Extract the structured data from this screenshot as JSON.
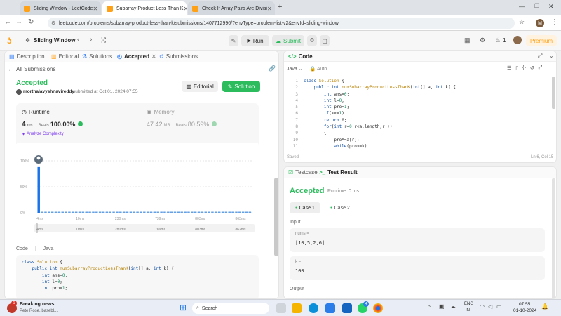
{
  "browser": {
    "tabs": [
      {
        "title": "Sliding Window - LeetCode"
      },
      {
        "title": "Subarray Product Less Than K"
      },
      {
        "title": "Check If Array Pairs Are Divisi"
      }
    ],
    "url": "leetcode.com/problems/subarray-product-less-than-k/submissions/1407712996/?envType=problem-list-v2&envId=sliding-window",
    "profile_initial": "M"
  },
  "lc_header": {
    "list_title": "Sliding Window",
    "run_label": "Run",
    "submit_label": "Submit",
    "streak": "1",
    "premium_label": "Premium"
  },
  "left_tabs": {
    "description": "Description",
    "editorial": "Editorial",
    "solutions": "Solutions",
    "accepted": "Accepted",
    "submissions": "Submissions"
  },
  "submission": {
    "back_label": "All Submissions",
    "status": "Accepted",
    "user": "morthalavyshnavireddy",
    "submitted_at": "submitted at Oct 01, 2024 07:55",
    "editorial_btn": "Editorial",
    "solution_btn": "Solution",
    "runtime_label": "Runtime",
    "runtime_value": "4",
    "runtime_unit": "ms",
    "runtime_beats_label": "Beats",
    "runtime_beats": "100.00%",
    "analyze_label": "Analyze Complexity",
    "memory_label": "Memory",
    "memory_value": "47.42",
    "memory_unit": "MB",
    "memory_beats_label": "Beats",
    "memory_beats": "80.59%"
  },
  "chart_data": {
    "type": "bar",
    "yticks": [
      "100%",
      "50%",
      "0%"
    ],
    "xticks": [
      "4ms",
      "10ms",
      "230ms",
      "739ms",
      "803ms",
      "863ms"
    ],
    "range_labels": [
      "4ms",
      "1mss",
      "280ms",
      "789ms",
      "803ms",
      "862ms"
    ],
    "values": [
      88,
      2,
      2,
      2,
      2,
      2,
      2,
      2,
      2,
      2,
      2,
      2,
      2,
      2,
      2,
      2,
      2,
      2,
      2,
      2,
      2,
      2,
      2,
      2,
      2,
      2,
      2,
      2,
      2,
      2,
      2,
      2,
      2,
      2,
      2,
      2,
      2,
      2,
      2,
      2,
      2,
      2,
      2,
      2,
      2,
      2,
      2,
      2,
      2,
      2,
      2,
      2,
      2,
      2,
      2,
      2,
      2,
      2,
      2,
      2,
      2,
      2,
      2
    ],
    "ylim": [
      0,
      100
    ],
    "highlight_index": 0
  },
  "code_section": {
    "label": "Code",
    "lang": "Java",
    "lines": [
      "class Solution {",
      "    public int numSubarrayProductLessThanK(int[] a, int k) {",
      "        int ans=0;",
      "        int l=0;",
      "        int pro=1;"
    ]
  },
  "editor": {
    "title": "Code",
    "lang": "Java",
    "auto": "Auto",
    "saved": "Saved",
    "cursor": "Ln 6, Col 15",
    "line_numbers": [
      "1",
      "2",
      "3",
      "4",
      "5",
      "6",
      "7",
      "8",
      "9",
      "10",
      "11"
    ],
    "lines": [
      "class Solution {",
      "    public int numSubarrayProductLessThanK(int[] a, int k) {",
      "        int ans=0;",
      "        int l=0;",
      "        int pro=1;",
      "        if(k<=1)",
      "        return 0;",
      "        for(int r=0;r<a.length;r++)",
      "        {",
      "            pro*=a[r];",
      "            while(pro>=k)"
    ]
  },
  "result": {
    "testcase_tab": "Testcase",
    "result_tab": "Test Result",
    "status": "Accepted",
    "runtime": "Runtime: 0 ms",
    "case1": "Case 1",
    "case2": "Case 2",
    "input_label": "Input",
    "nums_label": "nums =",
    "nums_value": "[10,5,2,6]",
    "k_label": "k =",
    "k_value": "100",
    "output_label": "Output"
  },
  "taskbar": {
    "news_title": "Breaking news",
    "news_sub": "Pete Rose, basebl...",
    "search": "Search",
    "lang": "ENG",
    "lang2": "IN",
    "time": "07:55",
    "date": "01-10-2024",
    "chrome_badge": "4",
    "news_badge": "1"
  }
}
